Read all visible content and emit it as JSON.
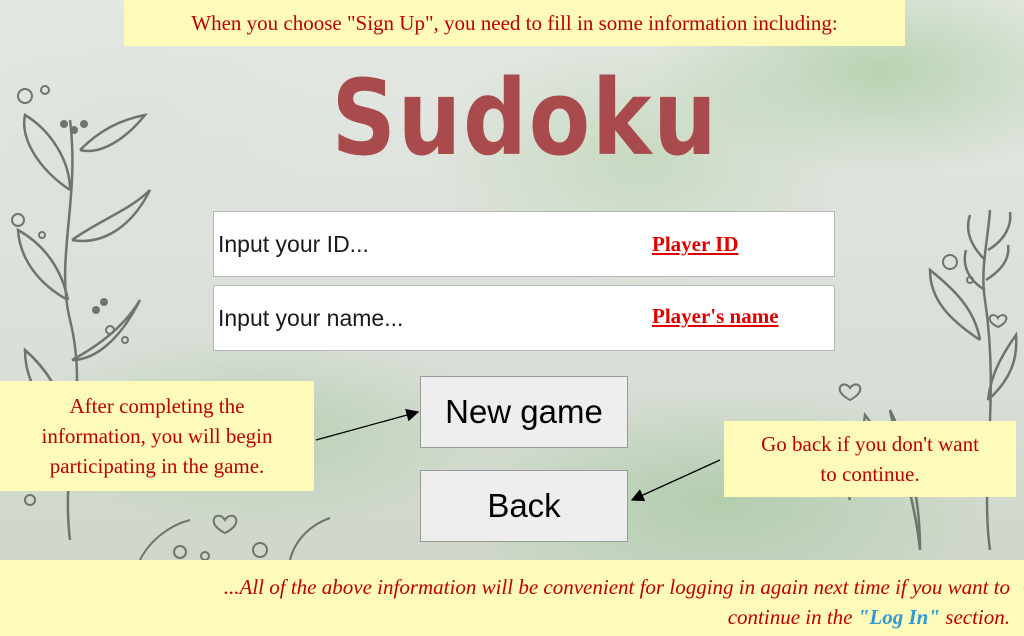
{
  "top_caption": "When you choose \"Sign Up\", you need to fill in some information including:",
  "app_title": "Sudoku",
  "fields": {
    "id": {
      "placeholder": "Input your ID...",
      "label": "Player ID"
    },
    "name": {
      "placeholder": "Input your name...",
      "label": "Player's name"
    }
  },
  "buttons": {
    "new_game": "New game",
    "back": "Back"
  },
  "callouts": {
    "left": [
      "After completing the",
      "information, you will begin",
      "participating in the game."
    ],
    "right": [
      "Go back if you don't want",
      "to continue."
    ]
  },
  "bottom_caption": {
    "line1": "...All of the above information will be convenient for logging in again next time if you want to",
    "line2_prefix": "continue in the ",
    "line2_link": "\"Log In\"",
    "line2_suffix": " section."
  },
  "colors": {
    "caption_bg": "#fdfbb7",
    "caption_text": "#c00000",
    "title": "#a94a4c",
    "field_label": "#e00000",
    "login_link": "#2e9ad6"
  }
}
